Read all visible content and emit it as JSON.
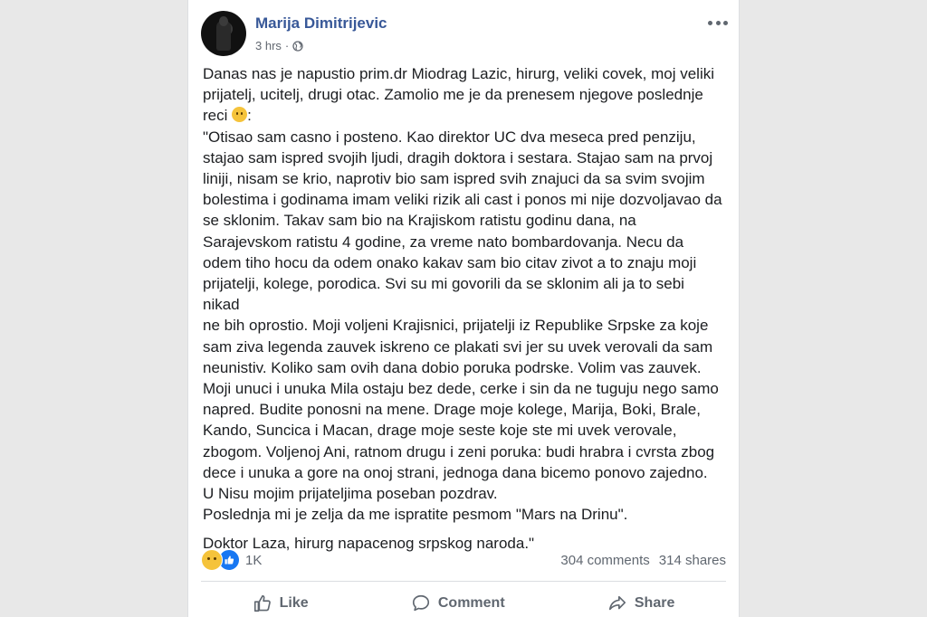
{
  "post": {
    "author": "Marija Dimitrijevic",
    "time": "3 hrs",
    "separator": "·",
    "privacy_icon": "globe-icon",
    "intro_lines": [
      "Danas nas je napustio prim.dr Miodrag Lazic, hirurg, veliki covek, moj veliki",
      "prijatelj, ucitelj, drugi otac. Zamolio me je da prenesem njegove poslednje",
      "reci",
      ":"
    ],
    "message_lines": [
      "\"Otisao sam casno i posteno. Kao direktor UC dva meseca pred penziju,",
      "stajao sam ispred svojih ljudi, dragih doktora i sestara. Stajao sam na prvoj",
      "liniji, nisam se krio, naprotiv bio sam ispred svih znajuci da sa svim svojim",
      "bolestima i godinama imam veliki rizik ali cast i ponos mi nije dozvoljavao da",
      "se sklonim. Takav sam bio na Krajiskom ratistu godinu dana, na",
      "Sarajevskom ratistu 4 godine, za vreme nato bombardovanja. Necu da",
      "odem tiho hocu da odem onako kakav sam bio citav zivot a to znaju moji",
      "prijatelji, kolege, porodica. Svi su mi govorili da se sklonim ali ja to sebi nikad",
      "ne bih oprostio. Moji voljeni Krajisnici, prijatelji iz Republike Srpske za koje",
      "sam ziva legenda zauvek iskreno ce plakati svi jer su uvek verovali da sam",
      "neunistiv. Koliko sam ovih dana dobio poruka podrske. Volim vas zauvek.",
      "Moji unuci i unuka Mila ostaju bez dede, cerke i sin da ne tuguju nego samo",
      "napred. Budite ponosni na mene. Drage moje kolege, Marija, Boki, Brale,",
      "Kando, Suncica i Macan, drage moje seste koje ste mi uvek verovale,",
      "zbogom. Voljenoj Ani, ratnom drugu i zeni poruka: budi hrabra i cvrsta zbog",
      "dece i unuka a gore na onoj strani, jednoga dana bicemo ponovo zajedno.",
      "U Nisu mojim prijateljima poseban pozdrav.",
      "Poslednja mi je zelja da me ispratite pesmom \"Mars na Drinu\"."
    ],
    "signature": "Doktor Laza, hirurg napacenog srpskog naroda.\"",
    "reaction_count": "1K",
    "comments": "304 comments",
    "shares": "314 shares",
    "actions": {
      "like": "Like",
      "comment": "Comment",
      "share": "Share"
    },
    "colors": {
      "author": "#385898",
      "like_blue": "#1877f2",
      "sad_yellow": "#f5c33b"
    }
  }
}
